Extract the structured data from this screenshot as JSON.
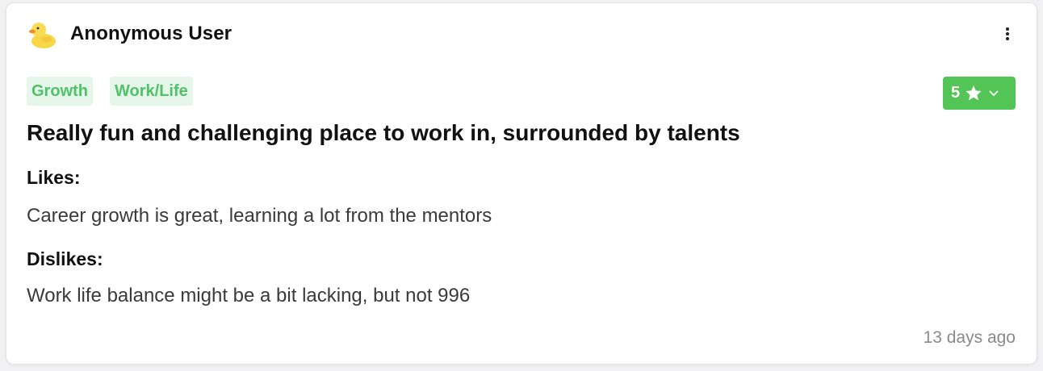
{
  "review": {
    "author": "Anonymous User",
    "tags": [
      "Growth",
      "Work/Life"
    ],
    "rating": "5",
    "title": "Really fun and challenging place to work in, surrounded by talents",
    "likes_label": "Likes:",
    "likes_text": "Career growth is great, learning a lot from the mentors",
    "dislikes_label": "Dislikes:",
    "dislikes_text": "Work life balance might be a bit lacking, but not 996",
    "timestamp": "13 days ago"
  },
  "icons": {
    "avatar": "duck-avatar-icon",
    "more": "more-vertical-icon",
    "star": "star-icon",
    "chevron": "chevron-down-icon"
  },
  "colors": {
    "tag_bg": "#e6f6e9",
    "tag_text": "#4fc26a",
    "rating_bg": "#53c456"
  }
}
